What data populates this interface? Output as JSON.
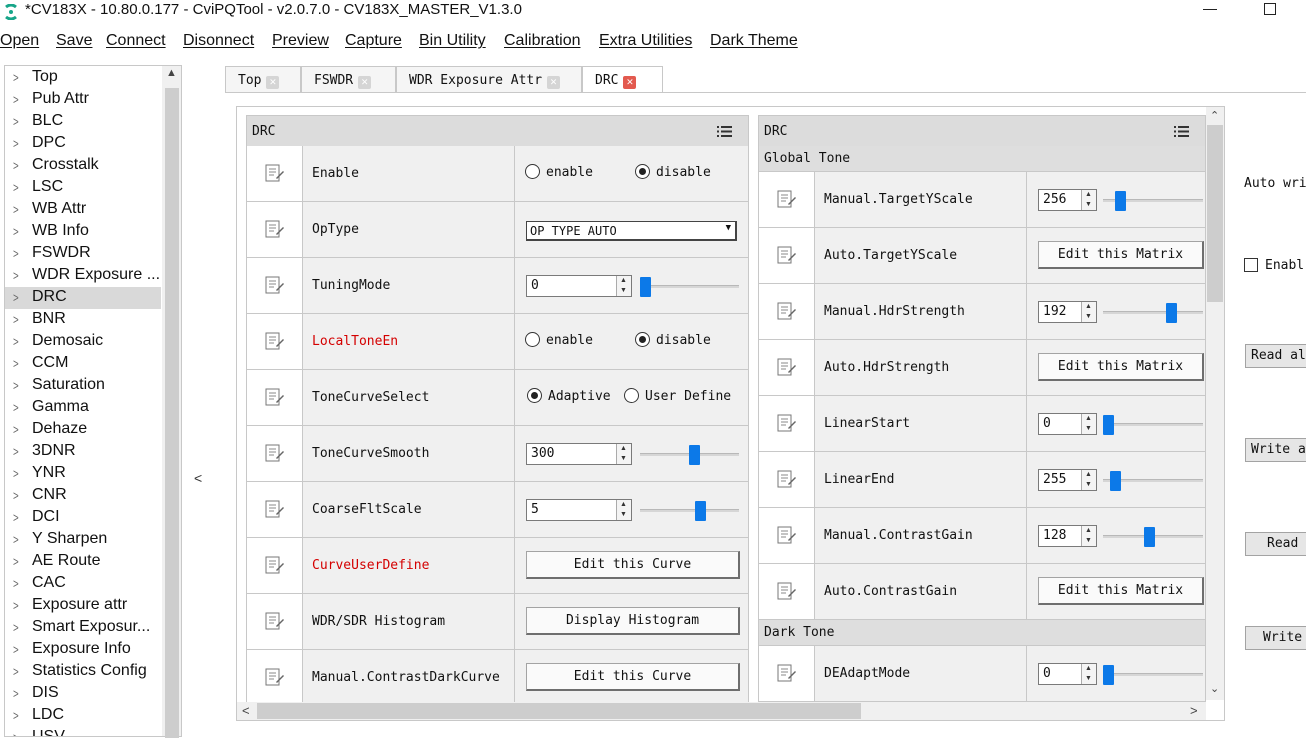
{
  "window": {
    "title": "*CV183X - 10.80.0.177 - CviPQTool - v2.0.7.0 - CV183X_MASTER_V1.3.0"
  },
  "menu": [
    "Open",
    "Save",
    "Connect",
    "Disonnect",
    "Preview",
    "Capture",
    "Bin Utility",
    "Calibration",
    "Extra Utilities",
    "Dark Theme"
  ],
  "sidebar": {
    "selected": "DRC",
    "items": [
      "Top",
      "Pub Attr",
      "BLC",
      "DPC",
      "Crosstalk",
      "LSC",
      "WB Attr",
      "WB Info",
      "FSWDR",
      "WDR Exposure ...",
      "DRC",
      "BNR",
      "Demosaic",
      "CCM",
      "Saturation",
      "Gamma",
      "Dehaze",
      "3DNR",
      "YNR",
      "CNR",
      "DCI",
      "Y Sharpen",
      "AE Route",
      "CAC",
      "Exposure attr",
      "Smart Exposur...",
      "Exposure Info",
      "Statistics Config",
      "DIS",
      "LDC",
      "USV"
    ]
  },
  "tabs": [
    {
      "label": "Top",
      "active": false
    },
    {
      "label": "FSWDR",
      "active": false
    },
    {
      "label": "WDR Exposure Attr",
      "active": false
    },
    {
      "label": "DRC",
      "active": true
    }
  ],
  "left_panel": {
    "title": "DRC",
    "rows": {
      "enable": {
        "name": "Enable",
        "opt1": "enable",
        "opt2": "disable",
        "selected": "disable"
      },
      "optype": {
        "name": "OpType",
        "value": "OP TYPE AUTO"
      },
      "tuningmode": {
        "name": "TuningMode",
        "value": "0",
        "level": 0.0
      },
      "localtoneen": {
        "name": "LocalToneEn",
        "opt1": "enable",
        "opt2": "disable",
        "selected": "disable"
      },
      "tonecurveselect": {
        "name": "ToneCurveSelect",
        "opt1": "Adaptive",
        "opt2": "User Define",
        "selected": "Adaptive"
      },
      "tonecurvesmooth": {
        "name": "ToneCurveSmooth",
        "value": "300",
        "level": 0.56
      },
      "coarsefltscale": {
        "name": "CoarseFltScale",
        "value": "5",
        "level": 0.62
      },
      "curveuserdefine": {
        "name": "CurveUserDefine",
        "button": "Edit this Curve"
      },
      "histogram": {
        "name": "WDR/SDR Histogram",
        "button": "Display Histogram"
      },
      "contrastdark": {
        "name": "Manual.ContrastDarkCurve",
        "button": "Edit this Curve"
      }
    }
  },
  "right_panel": {
    "title": "DRC",
    "section_global": "Global Tone",
    "section_dark": "Dark Tone",
    "rows": {
      "targetyscale_m": {
        "name": "Manual.TargetYScale",
        "value": "256",
        "level": 0.13
      },
      "targetyscale_a": {
        "name": "Auto.TargetYScale",
        "button": "Edit this Matrix"
      },
      "hdrstrength_m": {
        "name": "Manual.HdrStrength",
        "value": "192",
        "level": 0.71
      },
      "hdrstrength_a": {
        "name": "Auto.HdrStrength",
        "button": "Edit this Matrix"
      },
      "linearstart": {
        "name": "LinearStart",
        "value": "0",
        "level": 0.0
      },
      "linearend": {
        "name": "LinearEnd",
        "value": "255",
        "level": 0.08
      },
      "contrastgain_m": {
        "name": "Manual.ContrastGain",
        "value": "128",
        "level": 0.46
      },
      "contrastgain_a": {
        "name": "Auto.ContrastGain",
        "button": "Edit this Matrix"
      },
      "deadaptmode": {
        "name": "DEAdaptMode",
        "value": "0",
        "level": 0.0
      }
    }
  },
  "right_side": {
    "auto_write": "Auto wri",
    "enable_label": "Enabl",
    "read_all": "Read al",
    "write_all": "Write al",
    "read": "Read",
    "write": "Write"
  }
}
